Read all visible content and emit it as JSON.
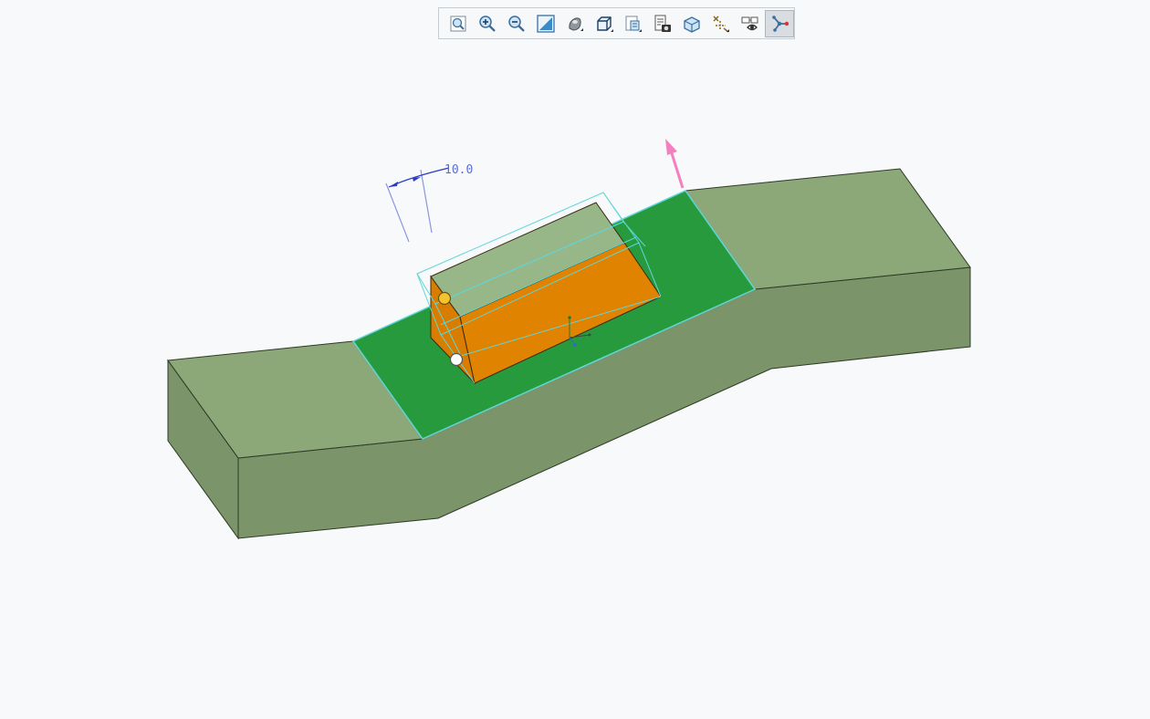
{
  "toolbar": {
    "buttons": [
      {
        "name": "refit-button",
        "icon": "refit-icon"
      },
      {
        "name": "zoom-in-button",
        "icon": "zoom-in-icon"
      },
      {
        "name": "zoom-out-button",
        "icon": "zoom-out-icon"
      },
      {
        "name": "repaint-button",
        "icon": "repaint-icon"
      },
      {
        "name": "display-style-button",
        "icon": "display-style-icon"
      },
      {
        "name": "saved-orientations-button",
        "icon": "saved-orientations-icon"
      },
      {
        "name": "view-manager-button",
        "icon": "view-manager-icon"
      },
      {
        "name": "perspective-view-button",
        "icon": "perspective-view-icon"
      },
      {
        "name": "section-view-button",
        "icon": "section-view-icon"
      },
      {
        "name": "datum-display-button",
        "icon": "datum-display-icon"
      },
      {
        "name": "annotation-display-button",
        "icon": "annotation-display-icon"
      },
      {
        "name": "spin-center-button",
        "icon": "spin-center-icon",
        "active": true
      }
    ]
  },
  "model": {
    "dimension_label": "10.0",
    "colors": {
      "base_top": "#8ca878",
      "base_side": "#7b946a",
      "selected_face": "#279a3e",
      "feature_top": "#98b788",
      "feature_front": "#e08300",
      "preview_outline": "#5fd6d8",
      "direction_arrow": "#f47fbf",
      "dimension": "#5a6fd8",
      "handle_active": "#f4c430",
      "handle_inactive": "#ffffff"
    }
  }
}
